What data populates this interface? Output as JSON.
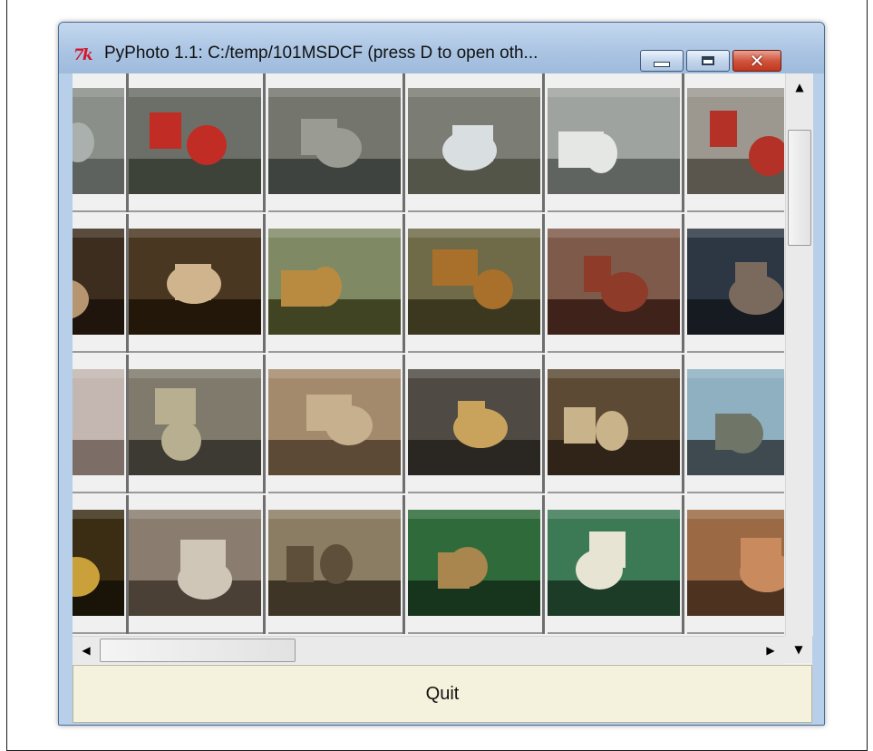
{
  "window": {
    "title": "PyPhoto 1.1: C:/temp/101MSDCF  (press D to open oth...",
    "logo_text": "7k",
    "controls": {
      "minimize": "minimize-icon",
      "maximize": "maximize-icon",
      "close": "close-icon"
    }
  },
  "gallery": {
    "rows": [
      [
        {
          "name": "photo-city-aerial",
          "bg": "#8a8f89",
          "accent": "#a9b0ad",
          "dark": "#5d625f"
        },
        {
          "name": "photo-street-buses",
          "bg": "#6c6f68",
          "accent": "#c12c24",
          "dark": "#3e433a"
        },
        {
          "name": "photo-river-eye",
          "bg": "#74766e",
          "accent": "#9a9c93",
          "dark": "#3f433f"
        },
        {
          "name": "photo-dome-roof",
          "bg": "#7b7c73",
          "accent": "#d9dee0",
          "dark": "#535548"
        },
        {
          "name": "photo-office-blocks",
          "bg": "#9fa39f",
          "accent": "#e5e7e4",
          "dark": "#5f6461"
        },
        {
          "name": "photo-street-bus",
          "bg": "#9c9890",
          "accent": "#b33126",
          "dark": "#5b564d"
        }
      ],
      [
        {
          "name": "photo-temple-columns-1",
          "bg": "#3c2d1e",
          "accent": "#b69570",
          "dark": "#1f150c"
        },
        {
          "name": "photo-temple-columns-2",
          "bg": "#4a3722",
          "accent": "#d0b48d",
          "dark": "#231709"
        },
        {
          "name": "photo-bronze-helmet",
          "bg": "#7f8a65",
          "accent": "#b98b41",
          "dark": "#414423"
        },
        {
          "name": "photo-clay-vessel",
          "bg": "#6f6a48",
          "accent": "#a9702b",
          "dark": "#3c3820"
        },
        {
          "name": "photo-carved-figure",
          "bg": "#7e5a4a",
          "accent": "#8e3b2a",
          "dark": "#3f2219"
        },
        {
          "name": "photo-statue-blue",
          "bg": "#2d3744",
          "accent": "#7a6a5e",
          "dark": "#161b21"
        }
      ],
      [
        {
          "name": "photo-sphinx",
          "bg": "#c4b6b0",
          "accent": "#e3c2a7",
          "dark": "#7d6d67"
        },
        {
          "name": "photo-mosaic-tiles",
          "bg": "#7f7a6b",
          "accent": "#b8ae90",
          "dark": "#3d3a33"
        },
        {
          "name": "photo-mosaic-lion",
          "bg": "#a48a6d",
          "accent": "#c7b08d",
          "dark": "#5d4a36"
        },
        {
          "name": "photo-gold-artifacts",
          "bg": "#4f4a44",
          "accent": "#c9a35c",
          "dark": "#2a2723"
        },
        {
          "name": "photo-small-figures",
          "bg": "#5c4a35",
          "accent": "#c9b38b",
          "dark": "#2f2417"
        },
        {
          "name": "photo-stone-relief",
          "bg": "#8eb0c0",
          "accent": "#6f7567",
          "dark": "#3e4a4f"
        }
      ],
      [
        {
          "name": "photo-gold-cylinder",
          "bg": "#3a2d14",
          "accent": "#c9a03a",
          "dark": "#1a1408"
        },
        {
          "name": "photo-glass-case",
          "bg": "#8a7d6f",
          "accent": "#cfc6b8",
          "dark": "#4a4036"
        },
        {
          "name": "photo-bronze-spears",
          "bg": "#8b7d63",
          "accent": "#5d4f3a",
          "dark": "#3e3527"
        },
        {
          "name": "photo-horned-helmet",
          "bg": "#2f6a3a",
          "accent": "#a9864d",
          "dark": "#17351d"
        },
        {
          "name": "photo-green-display",
          "bg": "#3c7a55",
          "accent": "#e8e4d4",
          "dark": "#1d3c28"
        },
        {
          "name": "photo-warrior-helmet",
          "bg": "#9b6a45",
          "accent": "#c98b5e",
          "dark": "#4e3220"
        }
      ]
    ]
  },
  "scrollbars": {
    "up": "▲",
    "down": "▼",
    "left": "◀",
    "right": "▶"
  },
  "quit_button": {
    "label": "Quit"
  }
}
